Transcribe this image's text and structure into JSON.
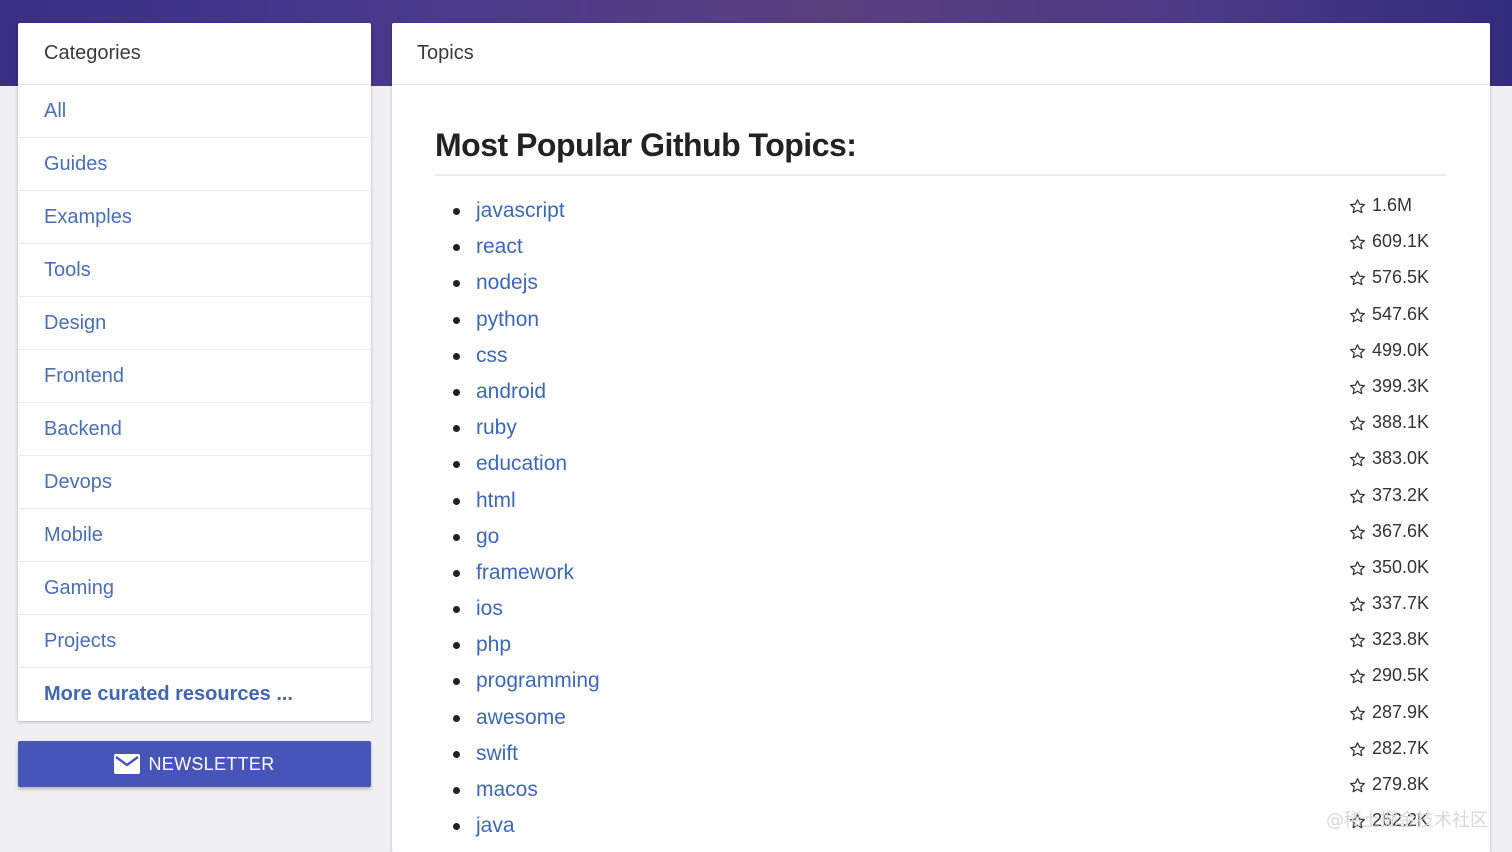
{
  "sidebar": {
    "title": "Categories",
    "items": [
      {
        "label": "All",
        "name": "sidebar-item-all"
      },
      {
        "label": "Guides",
        "name": "sidebar-item-guides"
      },
      {
        "label": "Examples",
        "name": "sidebar-item-examples"
      },
      {
        "label": "Tools",
        "name": "sidebar-item-tools"
      },
      {
        "label": "Design",
        "name": "sidebar-item-design"
      },
      {
        "label": "Frontend",
        "name": "sidebar-item-frontend"
      },
      {
        "label": "Backend",
        "name": "sidebar-item-backend"
      },
      {
        "label": "Devops",
        "name": "sidebar-item-devops"
      },
      {
        "label": "Mobile",
        "name": "sidebar-item-mobile"
      },
      {
        "label": "Gaming",
        "name": "sidebar-item-gaming"
      },
      {
        "label": "Projects",
        "name": "sidebar-item-projects"
      }
    ],
    "more_label": "More curated resources ..."
  },
  "newsletter": {
    "label": "NEWSLETTER",
    "icon": "mail-icon"
  },
  "main": {
    "header": "Topics",
    "title": "Most Popular Github Topics:",
    "topics": [
      {
        "name": "javascript",
        "stars": "1.6M"
      },
      {
        "name": "react",
        "stars": "609.1K"
      },
      {
        "name": "nodejs",
        "stars": "576.5K"
      },
      {
        "name": "python",
        "stars": "547.6K"
      },
      {
        "name": "css",
        "stars": "499.0K"
      },
      {
        "name": "android",
        "stars": "399.3K"
      },
      {
        "name": "ruby",
        "stars": "388.1K"
      },
      {
        "name": "education",
        "stars": "383.0K"
      },
      {
        "name": "html",
        "stars": "373.2K"
      },
      {
        "name": "go",
        "stars": "367.6K"
      },
      {
        "name": "framework",
        "stars": "350.0K"
      },
      {
        "name": "ios",
        "stars": "337.7K"
      },
      {
        "name": "php",
        "stars": "323.8K"
      },
      {
        "name": "programming",
        "stars": "290.5K"
      },
      {
        "name": "awesome",
        "stars": "287.9K"
      },
      {
        "name": "swift",
        "stars": "282.7K"
      },
      {
        "name": "macos",
        "stars": "279.8K"
      },
      {
        "name": "java",
        "stars": "262.2K"
      }
    ]
  },
  "watermark": "@稀土掘金技术社区",
  "colors": {
    "accent": "#4755b8",
    "link": "#3d68b6",
    "header_band": "#4a3b8c"
  }
}
